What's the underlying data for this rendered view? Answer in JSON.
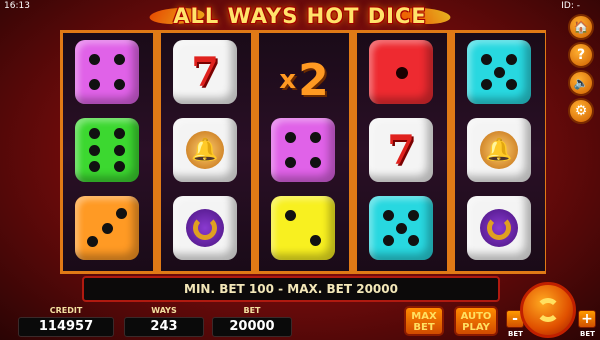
{
  "status": {
    "time": "16:13",
    "player_id": "ID: -"
  },
  "title": "ALL WAYS HOT DICE",
  "reels": [
    [
      {
        "type": "die",
        "pips": 4,
        "color": "#e062e8"
      },
      {
        "type": "die",
        "pips": 6,
        "color": "#3cd830"
      },
      {
        "type": "die",
        "pips": 3,
        "color": "#ff9a24"
      }
    ],
    [
      {
        "type": "seven",
        "color": "#f4f4f4"
      },
      {
        "type": "bell",
        "color": "#f4f4f4"
      },
      {
        "type": "horseshoe",
        "color": "#f4f4f4"
      }
    ],
    [
      {
        "type": "multiplier",
        "text": "x",
        "value": "2"
      },
      {
        "type": "die",
        "pips": 4,
        "color": "#e062e8"
      },
      {
        "type": "die",
        "pips": 2,
        "color": "#f8f020"
      }
    ],
    [
      {
        "type": "die",
        "pips": 1,
        "color": "#ee2a30"
      },
      {
        "type": "seven",
        "color": "#f4f4f4"
      },
      {
        "type": "die",
        "pips": 5,
        "color": "#28d8e0"
      }
    ],
    [
      {
        "type": "die",
        "pips": 5,
        "color": "#28d8e0"
      },
      {
        "type": "bell",
        "color": "#f4f4f4"
      },
      {
        "type": "horseshoe",
        "color": "#f4f4f4"
      }
    ]
  ],
  "info_text": "MIN. BET 100 - MAX. BET 20000",
  "credit": {
    "label": "CREDIT",
    "value": "114957"
  },
  "ways": {
    "label": "WAYS",
    "value": "243"
  },
  "bet": {
    "label": "BET",
    "value": "20000"
  },
  "buttons": {
    "max_bet_line1": "MAX",
    "max_bet_line2": "BET",
    "auto_play_line1": "AUTO",
    "auto_play_line2": "PLAY",
    "bet_minus": "-",
    "bet_plus": "+",
    "bet_label": "BET"
  },
  "side": {
    "home": "🏠",
    "help": "?",
    "sound": "🔈",
    "settings": "⚙"
  },
  "icons": {
    "spin": "refresh-arrows-icon"
  }
}
